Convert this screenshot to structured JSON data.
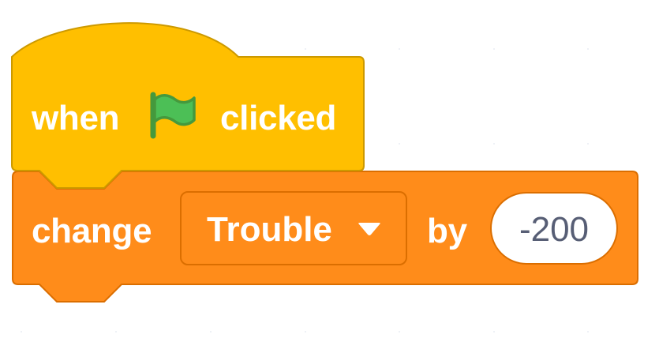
{
  "hat_block": {
    "name": "when-flag-clicked",
    "text_before": "when",
    "icon": "green-flag-icon",
    "text_after": "clicked",
    "fill_color": "#ffbf00",
    "border_color": "#cc9900"
  },
  "command_block": {
    "name": "change-variable-by",
    "text_before": "change",
    "variable": "Trouble",
    "dropdown_icon": "dropdown-arrow-icon",
    "text_middle": "by",
    "value": "-200",
    "fill_color": "#ff8c1a",
    "border_color": "#db6e00"
  },
  "colors": {
    "flag_fill": "#4cbf56",
    "flag_stroke": "#45993d",
    "input_text": "#575e75"
  }
}
